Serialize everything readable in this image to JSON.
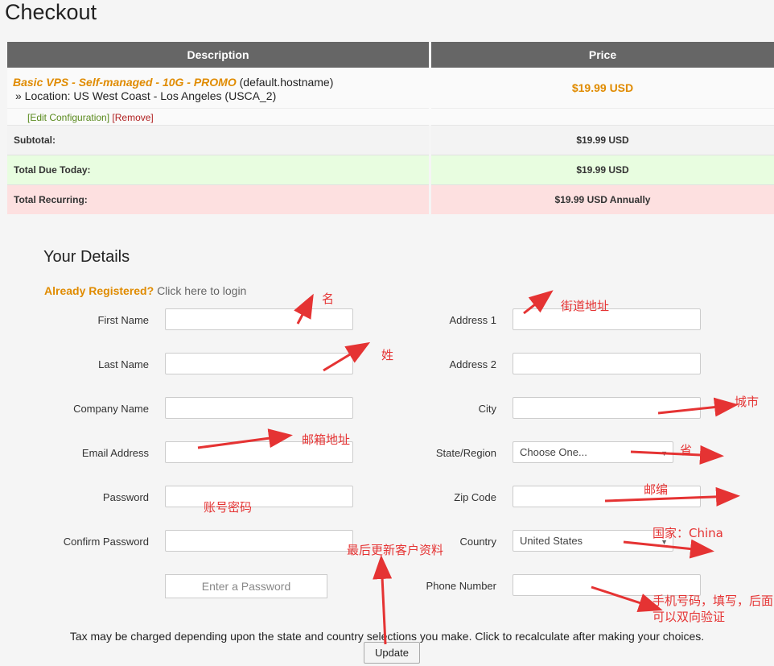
{
  "page": {
    "title": "Checkout"
  },
  "cart": {
    "headers": {
      "description": "Description",
      "price": "Price"
    },
    "product": {
      "name": "Basic VPS - Self-managed - 10G - PROMO",
      "hostname": "(default.hostname)",
      "location": "» Location: US West Coast - Los Angeles (USCA_2)",
      "price": "$19.99 USD"
    },
    "links": {
      "edit": "[Edit Configuration]",
      "remove": "[Remove]"
    },
    "summary": [
      {
        "label": "Subtotal:",
        "value": "$19.99 USD"
      },
      {
        "label": "Total Due Today:",
        "value": "$19.99 USD"
      },
      {
        "label": "Total Recurring:",
        "value": "$19.99 USD Annually"
      }
    ]
  },
  "details": {
    "title": "Your Details",
    "already": "Already Registered?",
    "login": "Click here to login",
    "left": [
      {
        "label": "First Name",
        "value": ""
      },
      {
        "label": "Last Name",
        "value": ""
      },
      {
        "label": "Company Name",
        "value": ""
      },
      {
        "label": "Email Address",
        "value": ""
      },
      {
        "label": "Password",
        "value": ""
      },
      {
        "label": "Confirm Password",
        "value": ""
      }
    ],
    "right": [
      {
        "label": "Address 1",
        "value": ""
      },
      {
        "label": "Address 2",
        "value": ""
      },
      {
        "label": "City",
        "value": ""
      },
      {
        "label": "State/Region",
        "value": "Choose One..."
      },
      {
        "label": "Zip Code",
        "value": ""
      },
      {
        "label": "Country",
        "value": "United States"
      },
      {
        "label": "Phone Number",
        "value": ""
      }
    ],
    "password_placeholder": "Enter a Password",
    "tax_note": "Tax may be charged depending upon the state and country selections you make. Click to recalculate after making your choices.",
    "update": "Update"
  },
  "annotations": {
    "first_name": "名",
    "last_name": "姓",
    "email": "邮箱地址",
    "password": "账号密码",
    "address": "街道地址",
    "city": "城市",
    "state": "省",
    "zip": "邮编",
    "country": "国家：China",
    "update": "最后更新客户资料",
    "phone": "手机号码，填写，后面可以双向验证"
  },
  "colors": {
    "annotation": "#e53333",
    "accent": "#e08b00"
  }
}
